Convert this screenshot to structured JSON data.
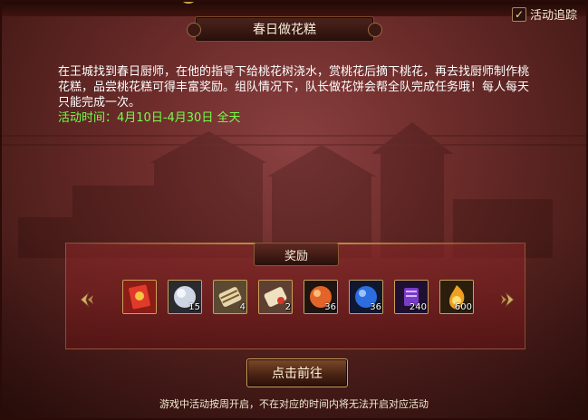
{
  "tracking": {
    "label": "活动追踪",
    "checked": true
  },
  "title": "春日做花糕",
  "description": {
    "text": "在王城找到春日厨师，在他的指导下给桃花树浇水，赏桃花后摘下桃花，再去找厨师制作桃花糕，品尝桃花糕可得丰富奖励。组队情况下，队长做花饼会帮全队完成任务哦！每人每天只能完成一次。",
    "time_label": "活动时间：",
    "time_value": "4月10日-4月30日 全天"
  },
  "rewards": {
    "header": "奖励",
    "items": [
      {
        "icon": "red-envelope-icon",
        "count": ""
      },
      {
        "icon": "silver-orb-icon",
        "count": "15"
      },
      {
        "icon": "scroll-icon",
        "count": "4"
      },
      {
        "icon": "letter-scroll-icon",
        "count": "2"
      },
      {
        "icon": "fire-orb-icon",
        "count": "36"
      },
      {
        "icon": "blue-orb-icon",
        "count": "36"
      },
      {
        "icon": "purple-book-icon",
        "count": "240"
      },
      {
        "icon": "flame-coin-icon",
        "count": "600"
      }
    ]
  },
  "go_button": "点击前往",
  "notice": "游戏中活动按周开启，不在对应的时间内将无法开启对应活动",
  "colors": {
    "time_text": "#74ff4a",
    "gold": "#caa05a"
  }
}
